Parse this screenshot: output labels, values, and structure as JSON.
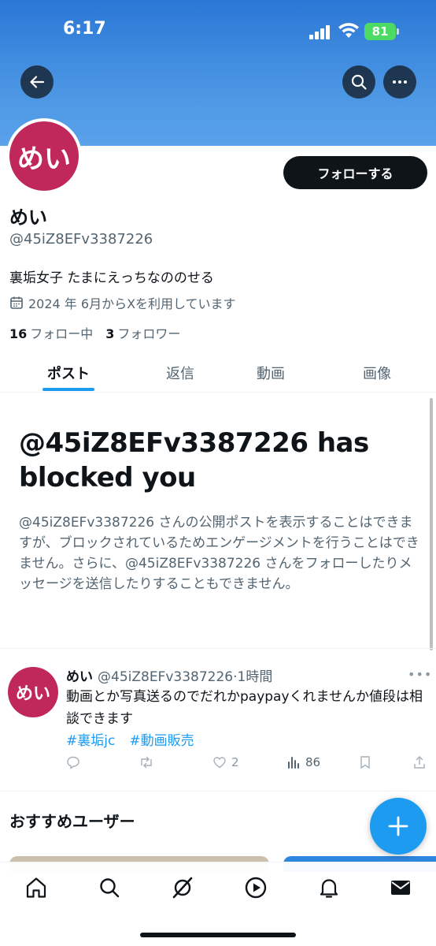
{
  "status_bar": {
    "time": "6:17",
    "battery": "81"
  },
  "profile": {
    "avatar_text": "めい",
    "name": "めい",
    "handle": "@45iZ8EFv3387226",
    "bio": "裏垢女子 たまにえっちなののせる",
    "joined": "2024 年 6月からXを利用しています",
    "following_count": "16",
    "following_label": "フォロー中",
    "followers_count": "3",
    "followers_label": "フォロワー",
    "follow_button": "フォローする"
  },
  "tabs": [
    {
      "label": "ポスト",
      "active": true
    },
    {
      "label": "返信"
    },
    {
      "label": "動画"
    },
    {
      "label": "画像"
    }
  ],
  "blocked": {
    "title": "@45iZ8EFv3387226 has blocked you",
    "description": "@45iZ8EFv3387226 さんの公開ポストを表示することはできますが、ブロックされているためエンゲージメントを行うことはできません。さらに、@45iZ8EFv3387226 さんをフォローしたりメッセージを送信したりすることもできません。"
  },
  "tweet": {
    "avatar_text": "めい",
    "name": "めい",
    "handle_time": "@45iZ8EFv3387226·1時間",
    "text": "動画とか写真送るのでだれかpaypayくれませんか値段は相談できます",
    "hashtags": [
      "#裏垢jc",
      "#動画販売"
    ],
    "likes": "2",
    "views": "86"
  },
  "suggestions_title": "おすすめユーザー",
  "colors": {
    "accent": "#1d9bf0",
    "avatar": "#c0285b",
    "banner": "#3a88e0"
  },
  "nav_icons": [
    "home-icon",
    "search-icon",
    "grok-icon",
    "video-icon",
    "notifications-icon",
    "messages-icon"
  ]
}
